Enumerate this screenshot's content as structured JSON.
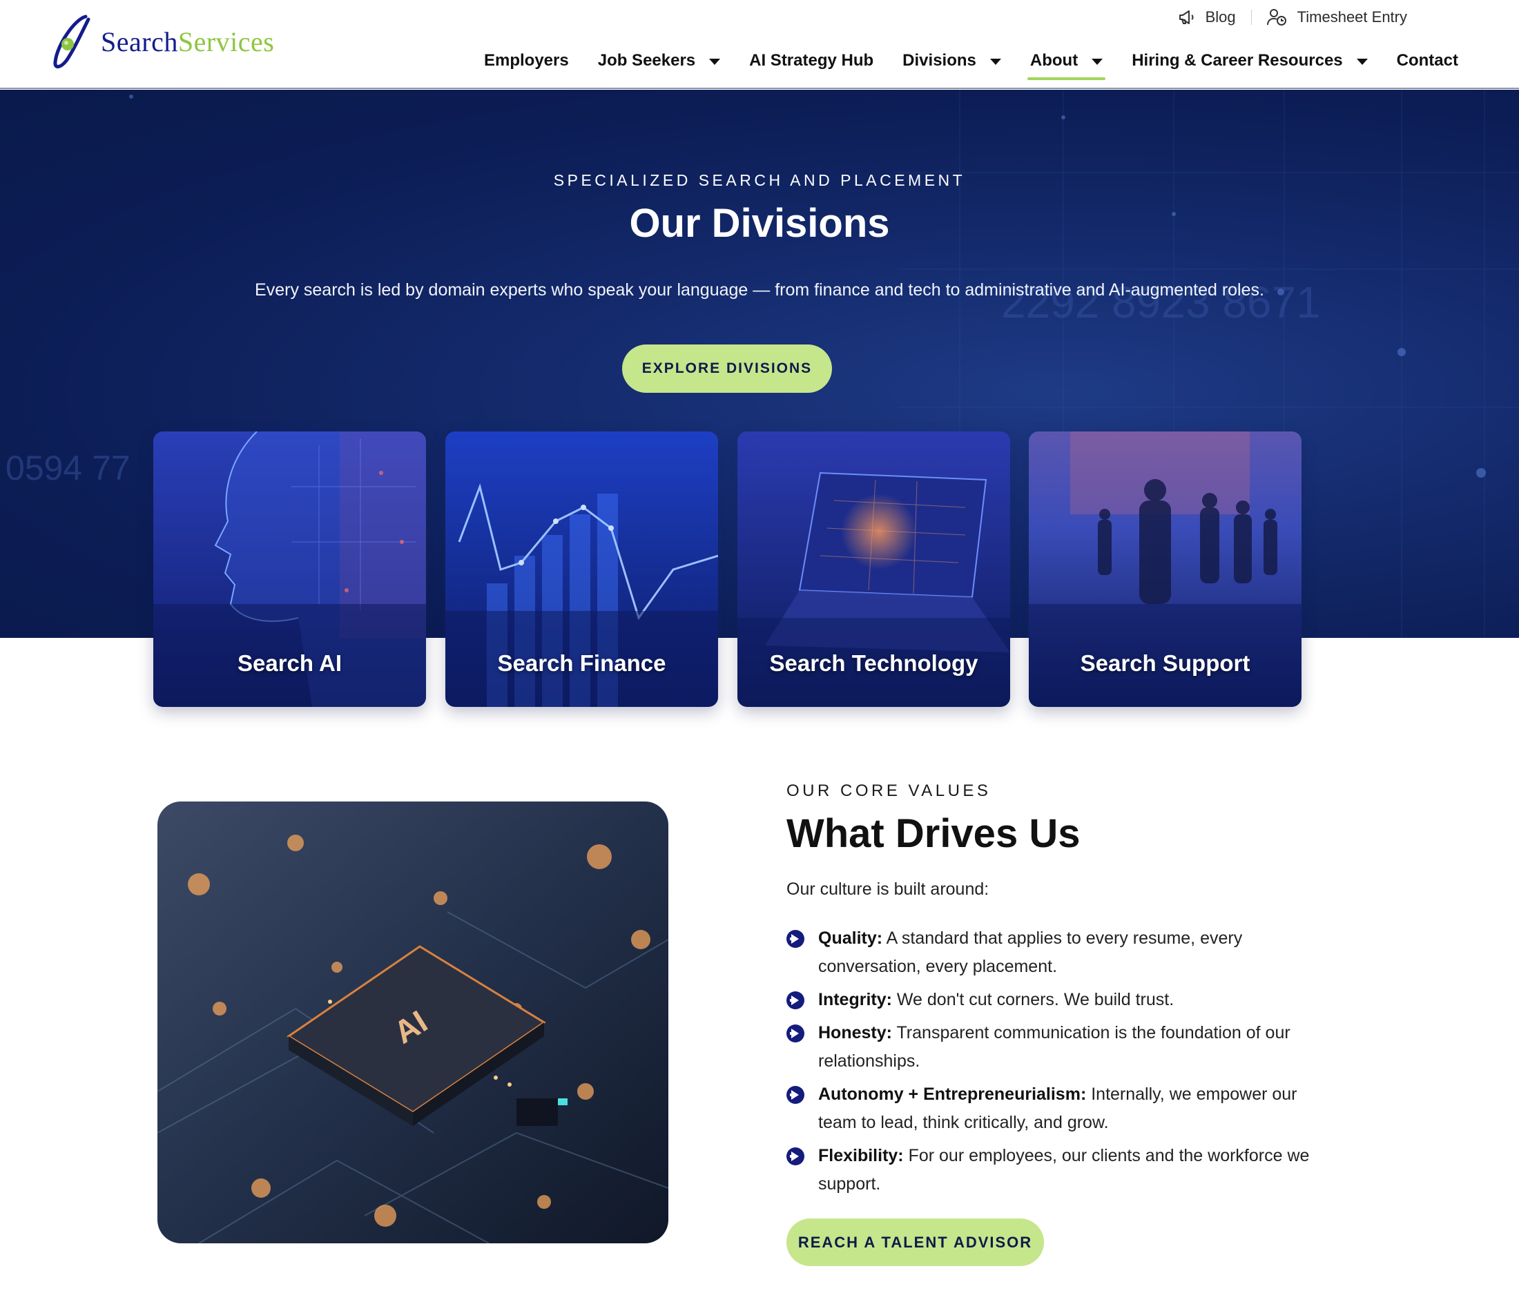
{
  "brand": {
    "name_part1": "Search",
    "name_part2": "Services",
    "colors": {
      "navy": "#141c8c",
      "green": "#8dc63f"
    }
  },
  "utility_nav": [
    {
      "label": "Blog",
      "icon": "megaphone-icon"
    },
    {
      "label": "Timesheet Entry",
      "icon": "user-clock-icon"
    }
  ],
  "nav": [
    {
      "label": "Employers",
      "dropdown": false,
      "active": false
    },
    {
      "label": "Job Seekers",
      "dropdown": true,
      "active": false
    },
    {
      "label": "AI Strategy Hub",
      "dropdown": false,
      "active": false
    },
    {
      "label": "Divisions",
      "dropdown": true,
      "active": false
    },
    {
      "label": "About",
      "dropdown": true,
      "active": true
    },
    {
      "label": "Hiring & Career Resources",
      "dropdown": true,
      "active": false
    },
    {
      "label": "Contact",
      "dropdown": false,
      "active": false
    }
  ],
  "hero": {
    "eyebrow": "SPECIALIZED SEARCH AND PLACEMENT",
    "title": "Our Divisions",
    "description": "Every search is led by domain experts who speak your language — from finance and tech to administrative and AI-augmented roles.",
    "cta": "EXPLORE DIVISIONS",
    "background_numbers": [
      "2292 8923 8671",
      "0594 77"
    ]
  },
  "divisions": [
    {
      "label": "Search AI"
    },
    {
      "label": "Search Finance"
    },
    {
      "label": "Search Technology"
    },
    {
      "label": "Search Support"
    }
  ],
  "values": {
    "eyebrow": "OUR CORE VALUES",
    "title": "What Drives Us",
    "intro": "Our culture is built around:",
    "items": [
      {
        "term": "Quality:",
        "text": " A standard that applies to every resume, every conversation, every placement."
      },
      {
        "term": "Integrity:",
        "text": " We don't cut corners. We build trust."
      },
      {
        "term": "Honesty:",
        "text": " Transparent communication is the foundation of our relationships."
      },
      {
        "term": "Autonomy + Entrepreneurialism:",
        "text": " Internally, we empower our team to lead, think critically, and grow."
      },
      {
        "term": "Flexibility:",
        "text": " For our employees, our clients and the workforce we support."
      }
    ],
    "cta": "REACH A TALENT ADVISOR",
    "image_chip_text": "AI"
  },
  "colors": {
    "hero_bg": "#0c1d55",
    "cta_green": "#c5e68b",
    "active_underline": "#a3d35a",
    "bullet_navy": "#141c7c"
  }
}
